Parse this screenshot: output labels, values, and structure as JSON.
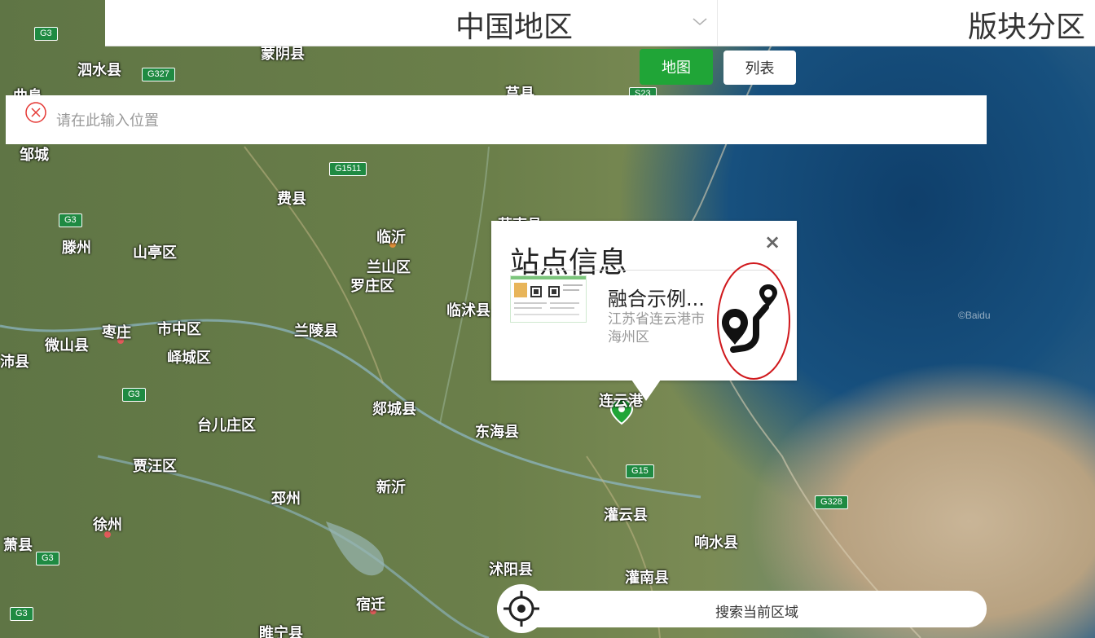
{
  "header": {
    "region_select": "中国地区",
    "block_tab": "版块分区"
  },
  "view_toggle": {
    "map_label": "地图",
    "list_label": "列表",
    "active": "map"
  },
  "search": {
    "placeholder": "请在此输入位置"
  },
  "map": {
    "places": [
      "蒙阴县",
      "泗水县",
      "曲阜",
      "邹城",
      "费县",
      "临沂",
      "滕州",
      "山亭区",
      "兰山区",
      "罗庄区",
      "临沭县",
      "枣庄",
      "市中区",
      "兰陵县",
      "微山县",
      "峄城区",
      "沛县",
      "郯城县",
      "东海县",
      "连云港",
      "台儿庄区",
      "贾汪区",
      "新沂",
      "邳州",
      "灌云县",
      "响水县",
      "徐州",
      "萧县",
      "沭阳县",
      "灌南县",
      "宿迁",
      "睢宁县",
      "莒县",
      "莒南县"
    ],
    "highways": [
      "G3",
      "G327",
      "G1511",
      "G3",
      "G3",
      "G15",
      "G328",
      "G3",
      "G3",
      "S23"
    ],
    "attribution": "©Baidu"
  },
  "popup": {
    "title": "站点信息",
    "close": "×",
    "station_name": "融合示例...",
    "station_address": "江苏省连云港市海州区"
  },
  "bottom": {
    "search_area_label": "搜索当前区域"
  },
  "colors": {
    "accent_green": "#20a537",
    "highway_green": "#1f8a42",
    "highlight_red": "#d0191d"
  }
}
